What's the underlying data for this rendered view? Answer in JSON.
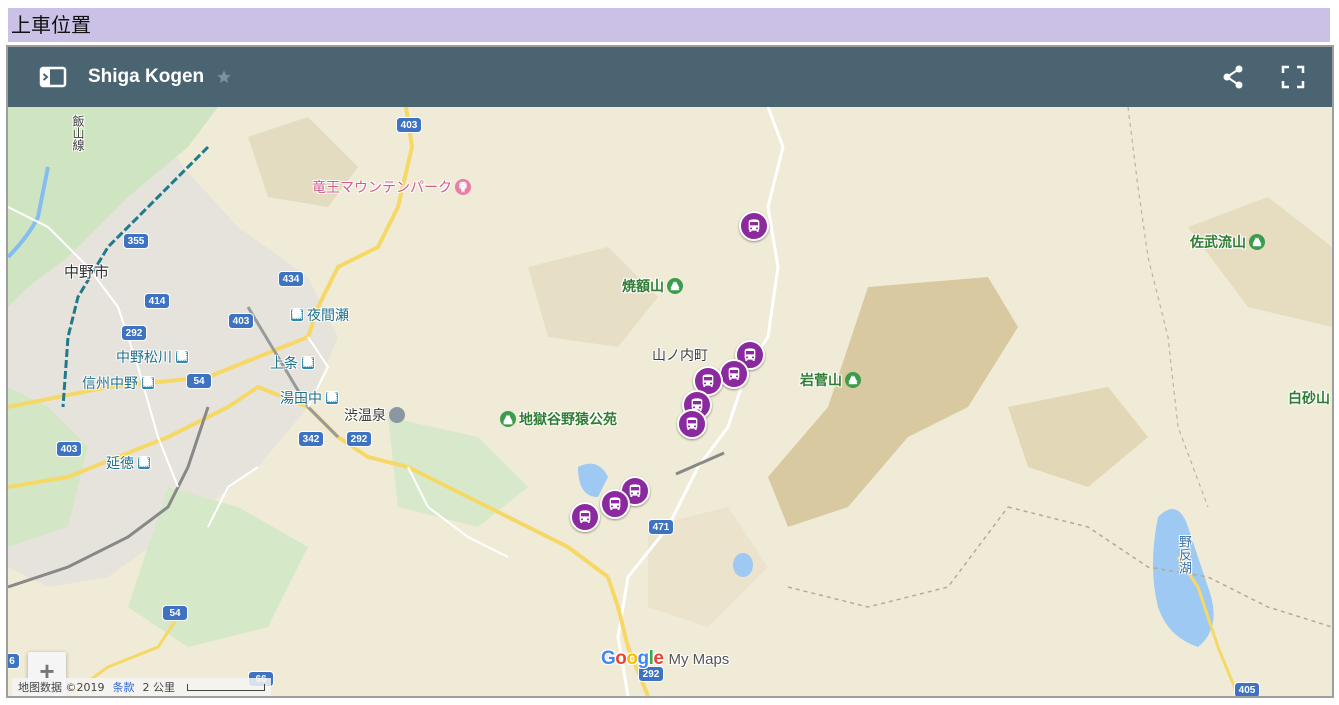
{
  "page": {
    "heading": "上車位置"
  },
  "map": {
    "title": "Shiga Kogen",
    "labels": {
      "ryuoo": "竜王マウンテンパーク",
      "nakano": "中野市",
      "yomase": "夜間瀬",
      "nakano_matsukawa": "中野松川",
      "kamijo": "上条",
      "shinshu_nakano": "信州中野",
      "yudanaka": "湯田中",
      "shibu_onsen": "渋温泉",
      "jigokudani": "地獄谷野猿公苑",
      "entoku": "延徳",
      "yakebitaiyama": "焼額山",
      "yamanouchi": "山ノ内町",
      "iwasugeyama": "岩菅山",
      "sabuyama": "佐武流山",
      "shirasunayama": "白砂山",
      "nozorico": "野反湖",
      "iiyama_line": "飯山線"
    },
    "road_shields": {
      "r403_top": "403",
      "r355": "355",
      "r434": "434",
      "r414": "414",
      "r292_left": "292",
      "r403_mid": "403",
      "r54_mid": "54",
      "r342": "342",
      "r292_center": "292",
      "r403_bottom": "403",
      "r471": "471",
      "r54_bottom": "54",
      "r292_bottom": "292",
      "r405": "405",
      "r66": "66",
      "r6_edge": "6"
    },
    "bus_stops": [
      {
        "name": "bus-stop-1"
      },
      {
        "name": "bus-stop-2"
      },
      {
        "name": "bus-stop-3"
      },
      {
        "name": "bus-stop-4"
      },
      {
        "name": "bus-stop-5"
      },
      {
        "name": "bus-stop-6"
      },
      {
        "name": "bus-stop-7"
      },
      {
        "name": "bus-stop-8"
      },
      {
        "name": "bus-stop-9"
      }
    ],
    "zoom": {
      "in": "+",
      "out": "−"
    },
    "branding": {
      "google": "Google",
      "my_maps": "My Maps"
    },
    "attribution": {
      "data": "地图数据 ©2019",
      "terms": "条款",
      "scale": "2 公里"
    },
    "colors": {
      "header": "#4a6472",
      "marker": "#8b2a9e",
      "heading_bg": "#cbc1e6",
      "road_shield": "#3e73c2"
    },
    "icons": [
      "legend-toggle-icon",
      "star-icon",
      "share-icon",
      "fullscreen-icon",
      "bus-icon",
      "train-station-icon",
      "mountain-icon",
      "search-pin-icon"
    ]
  }
}
